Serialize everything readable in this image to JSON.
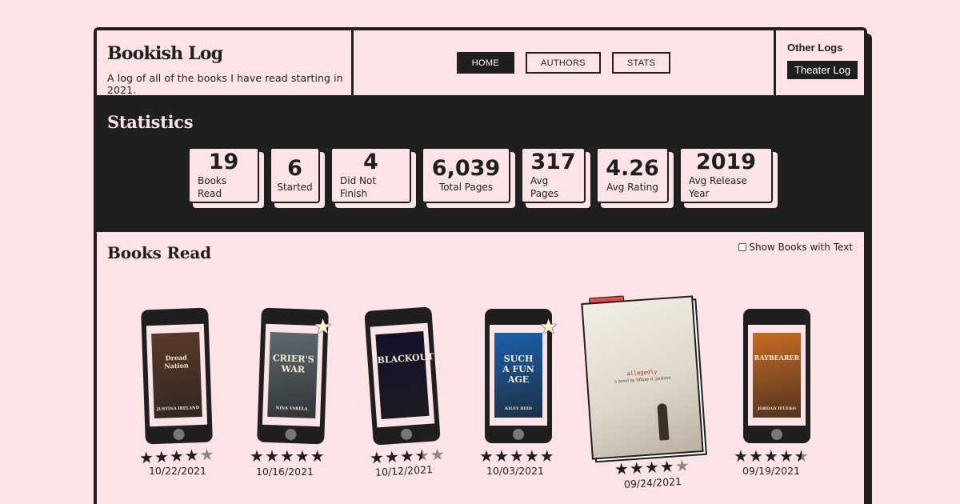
{
  "header": {
    "title": "Bookish Log",
    "subtitle": "A log of all of the books I have read starting in 2021.",
    "nav": [
      {
        "label": "HOME",
        "active": true
      },
      {
        "label": "AUTHORS",
        "active": false
      },
      {
        "label": "STATS",
        "active": false
      }
    ],
    "other_logs_title": "Other Logs",
    "theater_log_label": "Theater Log"
  },
  "statistics": {
    "title": "Statistics",
    "items": [
      {
        "value": "19",
        "label": "Books Read"
      },
      {
        "value": "6",
        "label": "Started"
      },
      {
        "value": "4",
        "label": "Did Not Finish"
      },
      {
        "value": "6,039",
        "label": "Total Pages"
      },
      {
        "value": "317",
        "label": "Avg Pages"
      },
      {
        "value": "4.26",
        "label": "Avg Rating"
      },
      {
        "value": "2019",
        "label": "Avg Release Year"
      }
    ]
  },
  "books_read": {
    "title": "Books Read",
    "show_text_label": "Show Books with Text",
    "show_text_checked": false,
    "books": [
      {
        "cover_text": [
          "Dread Nation",
          "JUSTINA IRELAND"
        ],
        "cover_color": "#5a3a2a",
        "rating": 4.0,
        "favorite": false,
        "date": "10/22/2021",
        "format": "ebook"
      },
      {
        "cover_text": [
          "CRIER'S",
          "WAR",
          "NINA VARELA"
        ],
        "cover_color": "#5e6a6e",
        "rating": 5.0,
        "favorite": true,
        "date": "10/16/2021",
        "format": "ebook"
      },
      {
        "cover_text": [
          "BLACKOUT"
        ],
        "cover_color": "#14102a",
        "rating": 3.5,
        "favorite": false,
        "date": "10/12/2021",
        "format": "ebook"
      },
      {
        "cover_text": [
          "SUCH",
          "A FUN",
          "AGE",
          "KILEY REID"
        ],
        "cover_color": "#1b5fa8",
        "rating": 5.0,
        "favorite": true,
        "date": "10/03/2021",
        "format": "ebook"
      },
      {
        "cover_text": [
          "allegedly",
          "a novel by tiffany d. jackson"
        ],
        "cover_color": "#e8e2d6",
        "rating": 4.0,
        "favorite": false,
        "date": "09/24/2021",
        "format": "physical"
      },
      {
        "cover_text": [
          "RAYBEARER",
          "JORDAN IFUEKO"
        ],
        "cover_color": "#c86a22",
        "rating": 4.5,
        "favorite": false,
        "date": "09/19/2021",
        "format": "ebook"
      }
    ]
  }
}
